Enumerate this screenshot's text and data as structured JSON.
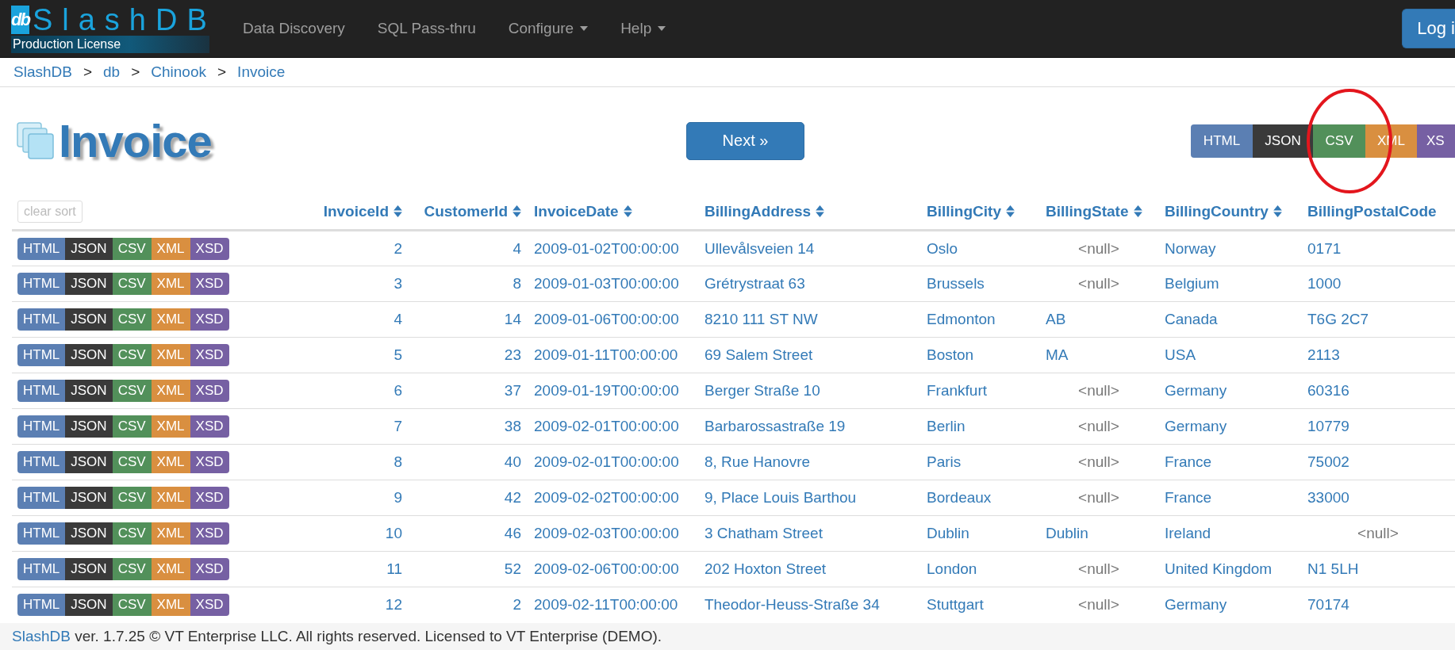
{
  "navbar": {
    "logo": {
      "badge": "db",
      "name": "SlashDB",
      "license": "Production License"
    },
    "items": [
      {
        "label": "Data Discovery",
        "dropdown": false
      },
      {
        "label": "SQL Pass-thru",
        "dropdown": false
      },
      {
        "label": "Configure",
        "dropdown": true
      },
      {
        "label": "Help",
        "dropdown": true
      }
    ],
    "login_button": "Log i"
  },
  "breadcrumb": [
    {
      "label": "SlashDB",
      "separator": ">"
    },
    {
      "label": "db",
      "separator": ">"
    },
    {
      "label": "Chinook",
      "separator": ">"
    },
    {
      "label": "Invoice"
    }
  ],
  "title": "Invoice",
  "next_button": "Next »",
  "formats": [
    {
      "label": "HTML",
      "color": "#5b7fb3"
    },
    {
      "label": "JSON",
      "color": "#3a3a3a"
    },
    {
      "label": "CSV",
      "color": "#52905a"
    },
    {
      "label": "XML",
      "color": "#d98f40"
    },
    {
      "label": "XS",
      "color": "#7660a3"
    }
  ],
  "clear_sort_button": {
    "label": "clear sort",
    "disabled": true
  },
  "table": {
    "columns": [
      {
        "label": "InvoiceId",
        "kind": "number",
        "sortable": true
      },
      {
        "label": "CustomerId",
        "kind": "number",
        "sortable": true
      },
      {
        "label": "InvoiceDate",
        "kind": "text",
        "sortable": true
      },
      {
        "label": "BillingAddress",
        "kind": "text",
        "sortable": true
      },
      {
        "label": "BillingCity",
        "kind": "text",
        "sortable": true
      },
      {
        "label": "BillingState",
        "kind": "text",
        "sortable": true
      },
      {
        "label": "BillingCountry",
        "kind": "text",
        "sortable": true
      },
      {
        "label": "BillingPostalCode",
        "kind": "text",
        "sortable": false
      }
    ],
    "rows": [
      {
        "formats": [
          {
            "label": "HTML",
            "color": "#5b7fb3"
          },
          {
            "label": "JSON",
            "color": "#3a3a3a"
          },
          {
            "label": "CSV",
            "color": "#52905a"
          },
          {
            "label": "XML",
            "color": "#d98f40"
          },
          {
            "label": "XSD",
            "color": "#7660a3"
          }
        ],
        "cells": [
          {
            "text": "2",
            "kind": "value"
          },
          {
            "text": "4",
            "kind": "value"
          },
          {
            "text": "2009-01-02T00:00:00",
            "kind": "value"
          },
          {
            "text": "Ullevålsveien 14",
            "kind": "value"
          },
          {
            "text": "Oslo",
            "kind": "value"
          },
          {
            "text": "<null>",
            "kind": "null"
          },
          {
            "text": "Norway",
            "kind": "value"
          },
          {
            "text": "0171",
            "kind": "value"
          }
        ]
      },
      {
        "formats": [
          {
            "label": "HTML",
            "color": "#5b7fb3"
          },
          {
            "label": "JSON",
            "color": "#3a3a3a"
          },
          {
            "label": "CSV",
            "color": "#52905a"
          },
          {
            "label": "XML",
            "color": "#d98f40"
          },
          {
            "label": "XSD",
            "color": "#7660a3"
          }
        ],
        "cells": [
          {
            "text": "3",
            "kind": "value"
          },
          {
            "text": "8",
            "kind": "value"
          },
          {
            "text": "2009-01-03T00:00:00",
            "kind": "value"
          },
          {
            "text": "Grétrystraat 63",
            "kind": "value"
          },
          {
            "text": "Brussels",
            "kind": "value"
          },
          {
            "text": "<null>",
            "kind": "null"
          },
          {
            "text": "Belgium",
            "kind": "value"
          },
          {
            "text": "1000",
            "kind": "value"
          }
        ]
      },
      {
        "formats": [
          {
            "label": "HTML",
            "color": "#5b7fb3"
          },
          {
            "label": "JSON",
            "color": "#3a3a3a"
          },
          {
            "label": "CSV",
            "color": "#52905a"
          },
          {
            "label": "XML",
            "color": "#d98f40"
          },
          {
            "label": "XSD",
            "color": "#7660a3"
          }
        ],
        "cells": [
          {
            "text": "4",
            "kind": "value"
          },
          {
            "text": "14",
            "kind": "value"
          },
          {
            "text": "2009-01-06T00:00:00",
            "kind": "value"
          },
          {
            "text": "8210 111 ST NW",
            "kind": "value"
          },
          {
            "text": "Edmonton",
            "kind": "value"
          },
          {
            "text": "AB",
            "kind": "value"
          },
          {
            "text": "Canada",
            "kind": "value"
          },
          {
            "text": "T6G 2C7",
            "kind": "value"
          }
        ]
      },
      {
        "formats": [
          {
            "label": "HTML",
            "color": "#5b7fb3"
          },
          {
            "label": "JSON",
            "color": "#3a3a3a"
          },
          {
            "label": "CSV",
            "color": "#52905a"
          },
          {
            "label": "XML",
            "color": "#d98f40"
          },
          {
            "label": "XSD",
            "color": "#7660a3"
          }
        ],
        "cells": [
          {
            "text": "5",
            "kind": "value"
          },
          {
            "text": "23",
            "kind": "value"
          },
          {
            "text": "2009-01-11T00:00:00",
            "kind": "value"
          },
          {
            "text": "69 Salem Street",
            "kind": "value"
          },
          {
            "text": "Boston",
            "kind": "value"
          },
          {
            "text": "MA",
            "kind": "value"
          },
          {
            "text": "USA",
            "kind": "value"
          },
          {
            "text": "2113",
            "kind": "value"
          }
        ]
      },
      {
        "formats": [
          {
            "label": "HTML",
            "color": "#5b7fb3"
          },
          {
            "label": "JSON",
            "color": "#3a3a3a"
          },
          {
            "label": "CSV",
            "color": "#52905a"
          },
          {
            "label": "XML",
            "color": "#d98f40"
          },
          {
            "label": "XSD",
            "color": "#7660a3"
          }
        ],
        "cells": [
          {
            "text": "6",
            "kind": "value"
          },
          {
            "text": "37",
            "kind": "value"
          },
          {
            "text": "2009-01-19T00:00:00",
            "kind": "value"
          },
          {
            "text": "Berger Straße 10",
            "kind": "value"
          },
          {
            "text": "Frankfurt",
            "kind": "value"
          },
          {
            "text": "<null>",
            "kind": "null"
          },
          {
            "text": "Germany",
            "kind": "value"
          },
          {
            "text": "60316",
            "kind": "value"
          }
        ]
      },
      {
        "formats": [
          {
            "label": "HTML",
            "color": "#5b7fb3"
          },
          {
            "label": "JSON",
            "color": "#3a3a3a"
          },
          {
            "label": "CSV",
            "color": "#52905a"
          },
          {
            "label": "XML",
            "color": "#d98f40"
          },
          {
            "label": "XSD",
            "color": "#7660a3"
          }
        ],
        "cells": [
          {
            "text": "7",
            "kind": "value"
          },
          {
            "text": "38",
            "kind": "value"
          },
          {
            "text": "2009-02-01T00:00:00",
            "kind": "value"
          },
          {
            "text": "Barbarossastraße 19",
            "kind": "value"
          },
          {
            "text": "Berlin",
            "kind": "value"
          },
          {
            "text": "<null>",
            "kind": "null"
          },
          {
            "text": "Germany",
            "kind": "value"
          },
          {
            "text": "10779",
            "kind": "value"
          }
        ]
      },
      {
        "formats": [
          {
            "label": "HTML",
            "color": "#5b7fb3"
          },
          {
            "label": "JSON",
            "color": "#3a3a3a"
          },
          {
            "label": "CSV",
            "color": "#52905a"
          },
          {
            "label": "XML",
            "color": "#d98f40"
          },
          {
            "label": "XSD",
            "color": "#7660a3"
          }
        ],
        "cells": [
          {
            "text": "8",
            "kind": "value"
          },
          {
            "text": "40",
            "kind": "value"
          },
          {
            "text": "2009-02-01T00:00:00",
            "kind": "value"
          },
          {
            "text": "8, Rue Hanovre",
            "kind": "value"
          },
          {
            "text": "Paris",
            "kind": "value"
          },
          {
            "text": "<null>",
            "kind": "null"
          },
          {
            "text": "France",
            "kind": "value"
          },
          {
            "text": "75002",
            "kind": "value"
          }
        ]
      },
      {
        "formats": [
          {
            "label": "HTML",
            "color": "#5b7fb3"
          },
          {
            "label": "JSON",
            "color": "#3a3a3a"
          },
          {
            "label": "CSV",
            "color": "#52905a"
          },
          {
            "label": "XML",
            "color": "#d98f40"
          },
          {
            "label": "XSD",
            "color": "#7660a3"
          }
        ],
        "cells": [
          {
            "text": "9",
            "kind": "value"
          },
          {
            "text": "42",
            "kind": "value"
          },
          {
            "text": "2009-02-02T00:00:00",
            "kind": "value"
          },
          {
            "text": "9, Place Louis Barthou",
            "kind": "value"
          },
          {
            "text": "Bordeaux",
            "kind": "value"
          },
          {
            "text": "<null>",
            "kind": "null"
          },
          {
            "text": "France",
            "kind": "value"
          },
          {
            "text": "33000",
            "kind": "value"
          }
        ]
      },
      {
        "formats": [
          {
            "label": "HTML",
            "color": "#5b7fb3"
          },
          {
            "label": "JSON",
            "color": "#3a3a3a"
          },
          {
            "label": "CSV",
            "color": "#52905a"
          },
          {
            "label": "XML",
            "color": "#d98f40"
          },
          {
            "label": "XSD",
            "color": "#7660a3"
          }
        ],
        "cells": [
          {
            "text": "10",
            "kind": "value"
          },
          {
            "text": "46",
            "kind": "value"
          },
          {
            "text": "2009-02-03T00:00:00",
            "kind": "value"
          },
          {
            "text": "3 Chatham Street",
            "kind": "value"
          },
          {
            "text": "Dublin",
            "kind": "value"
          },
          {
            "text": "Dublin",
            "kind": "value"
          },
          {
            "text": "Ireland",
            "kind": "value"
          },
          {
            "text": "<null>",
            "kind": "null"
          }
        ]
      },
      {
        "formats": [
          {
            "label": "HTML",
            "color": "#5b7fb3"
          },
          {
            "label": "JSON",
            "color": "#3a3a3a"
          },
          {
            "label": "CSV",
            "color": "#52905a"
          },
          {
            "label": "XML",
            "color": "#d98f40"
          },
          {
            "label": "XSD",
            "color": "#7660a3"
          }
        ],
        "cells": [
          {
            "text": "11",
            "kind": "value"
          },
          {
            "text": "52",
            "kind": "value"
          },
          {
            "text": "2009-02-06T00:00:00",
            "kind": "value"
          },
          {
            "text": "202 Hoxton Street",
            "kind": "value"
          },
          {
            "text": "London",
            "kind": "value"
          },
          {
            "text": "<null>",
            "kind": "null"
          },
          {
            "text": "United Kingdom",
            "kind": "value"
          },
          {
            "text": "N1 5LH",
            "kind": "value"
          }
        ]
      },
      {
        "formats": [
          {
            "label": "HTML",
            "color": "#5b7fb3"
          },
          {
            "label": "JSON",
            "color": "#3a3a3a"
          },
          {
            "label": "CSV",
            "color": "#52905a"
          },
          {
            "label": "XML",
            "color": "#d98f40"
          },
          {
            "label": "XSD",
            "color": "#7660a3"
          }
        ],
        "cells": [
          {
            "text": "12",
            "kind": "value"
          },
          {
            "text": "2",
            "kind": "value"
          },
          {
            "text": "2009-02-11T00:00:00",
            "kind": "value"
          },
          {
            "text": "Theodor-Heuss-Straße 34",
            "kind": "value"
          },
          {
            "text": "Stuttgart",
            "kind": "value"
          },
          {
            "text": "<null>",
            "kind": "null"
          },
          {
            "text": "Germany",
            "kind": "value"
          },
          {
            "text": "70174",
            "kind": "value"
          }
        ]
      }
    ]
  },
  "footer": {
    "link": "SlashDB",
    "text": " ver. 1.7.25 © VT Enterprise LLC. All rights reserved. Licensed to VT Enterprise (DEMO)."
  }
}
